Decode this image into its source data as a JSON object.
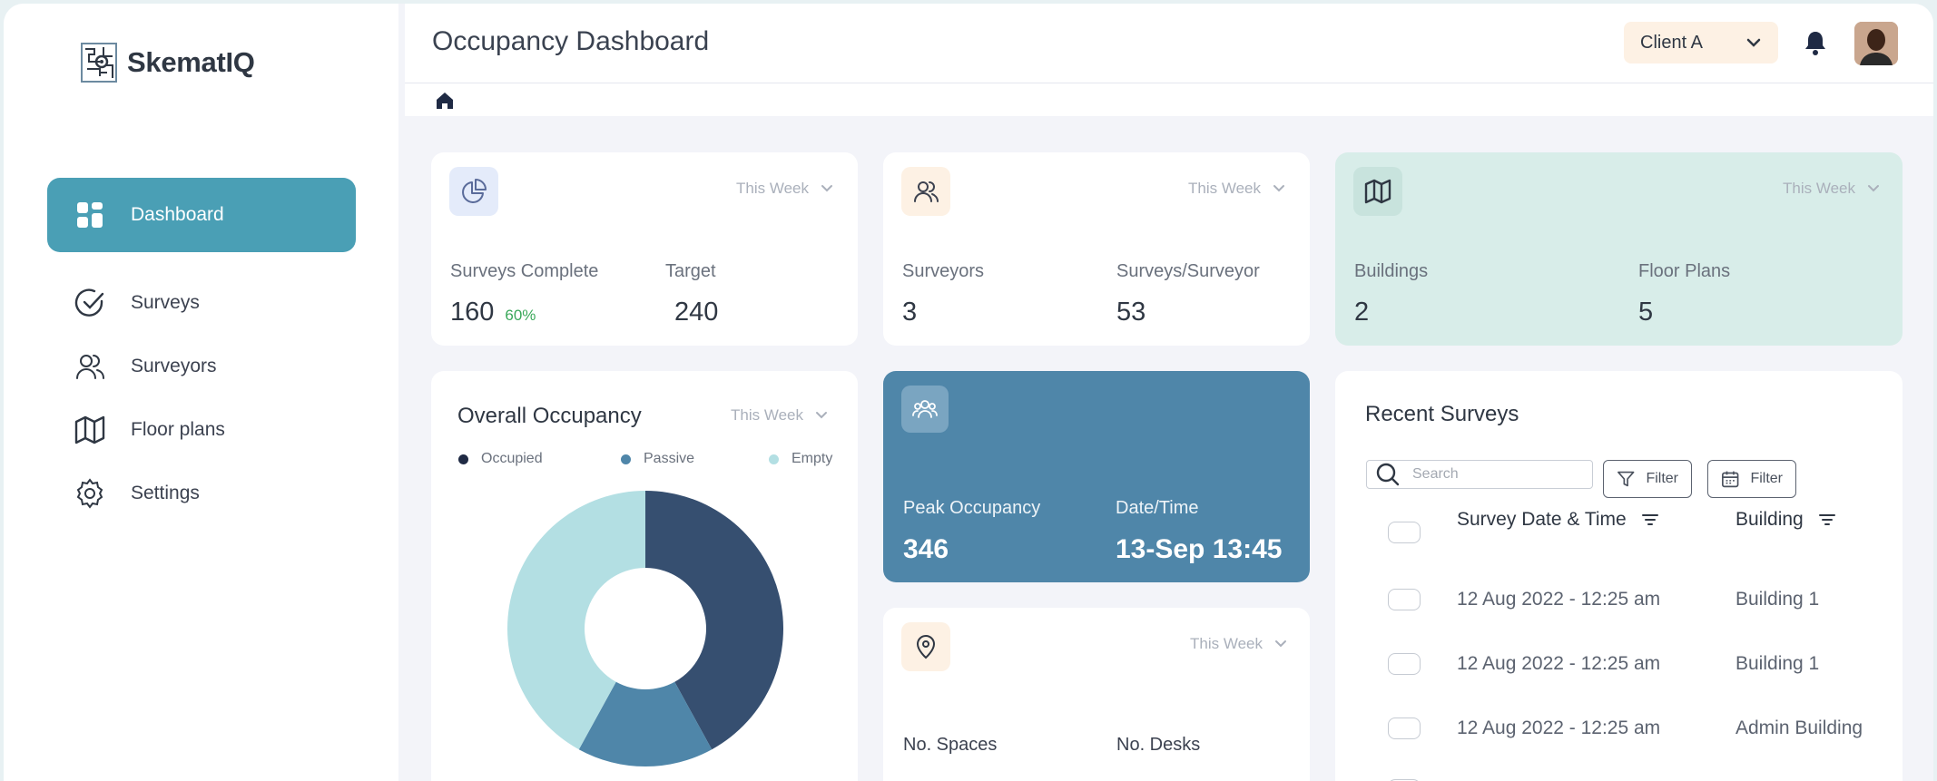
{
  "app": {
    "name": "SkematIQ"
  },
  "nav": [
    {
      "label": "Dashboard",
      "icon": "grid-icon",
      "active": true
    },
    {
      "label": "Surveys",
      "icon": "check-circle-icon",
      "active": false
    },
    {
      "label": "Surveyors",
      "icon": "users-icon",
      "active": false
    },
    {
      "label": "Floor plans",
      "icon": "map-icon",
      "active": false
    },
    {
      "label": "Settings",
      "icon": "gear-icon",
      "active": false
    }
  ],
  "header": {
    "title": "Occupancy Dashboard",
    "client": "Client A"
  },
  "cards": {
    "surveys": {
      "period": "This Week",
      "label_a": "Surveys Complete",
      "value_a": "160",
      "pct": "60%",
      "label_b": "Target",
      "value_b": "240"
    },
    "surveyors": {
      "period": "This Week",
      "label_a": "Surveyors",
      "value_a": "3",
      "label_b": "Surveys/Surveyor",
      "value_b": "53"
    },
    "buildings": {
      "period": "This Week",
      "label_a": "Buildings",
      "value_a": "2",
      "label_b": "Floor Plans",
      "value_b": "5"
    },
    "peak": {
      "label_a": "Peak Occupancy",
      "value_a": "346",
      "label_b": "Date/Time",
      "value_b": "13-Sep 13:45"
    },
    "spaces": {
      "period": "This Week",
      "label_a": "No. Spaces",
      "label_b": "No. Desks"
    }
  },
  "occupancy": {
    "title": "Overall Occupancy",
    "period": "This Week",
    "legend": [
      "Occupied",
      "Passive",
      "Empty"
    ]
  },
  "chart_data": {
    "type": "pie",
    "categories": [
      "Occupied",
      "Passive",
      "Empty"
    ],
    "values": [
      42,
      16,
      42
    ],
    "colors": [
      "#364f70",
      "#4f86a9",
      "#b3dfe3"
    ],
    "donut": true
  },
  "recent": {
    "title": "Recent Surveys",
    "search_placeholder": "Search",
    "filter_label": "Filter",
    "date_filter_label": "Filter",
    "columns": [
      "Survey Date & Time",
      "Building"
    ],
    "rows": [
      {
        "date": "12 Aug 2022 - 12:25 am",
        "building": "Building 1"
      },
      {
        "date": "12 Aug 2022 - 12:25 am",
        "building": "Building 1"
      },
      {
        "date": "12 Aug 2022 - 12:25 am",
        "building": "Admin Building"
      }
    ]
  },
  "colors": {
    "accent": "#4a9fb5",
    "peak_card": "#4f86a9",
    "mint_card": "#d8ede9",
    "client_bg": "#fdf1e4"
  }
}
